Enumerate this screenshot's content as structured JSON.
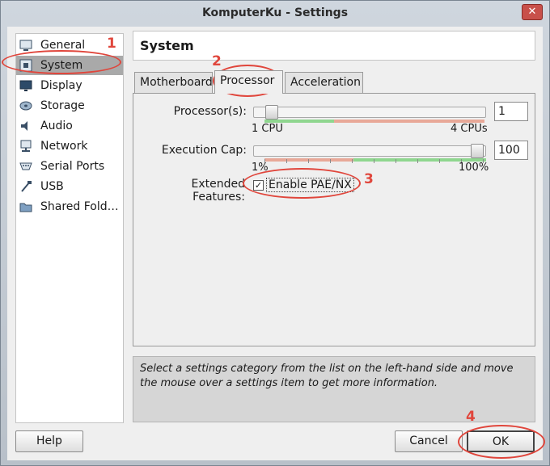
{
  "window": {
    "title": "KomputerKu - Settings",
    "close_glyph": "✕"
  },
  "sidebar": {
    "items": [
      {
        "label": "General",
        "icon": "general-icon"
      },
      {
        "label": "System",
        "icon": "system-icon",
        "selected": true
      },
      {
        "label": "Display",
        "icon": "display-icon"
      },
      {
        "label": "Storage",
        "icon": "storage-icon"
      },
      {
        "label": "Audio",
        "icon": "audio-icon"
      },
      {
        "label": "Network",
        "icon": "network-icon"
      },
      {
        "label": "Serial Ports",
        "icon": "serial-ports-icon"
      },
      {
        "label": "USB",
        "icon": "usb-icon"
      },
      {
        "label": "Shared Fold…",
        "icon": "shared-folders-icon"
      }
    ]
  },
  "main": {
    "title": "System",
    "tabs": [
      {
        "label": "Motherboard",
        "active": false
      },
      {
        "label": "Processor",
        "active": true
      },
      {
        "label": "Acceleration",
        "active": false
      }
    ],
    "processor": {
      "processors_label": "Processor(s):",
      "processors_value": "1",
      "processors_min_label": "1 CPU",
      "processors_max_label": "4 CPUs",
      "processors_level": 0.0,
      "exec_cap_label": "Execution Cap:",
      "exec_cap_value": "100",
      "exec_cap_min_label": "1%",
      "exec_cap_max_label": "100%",
      "exec_cap_level": 1.0,
      "extended_features_label": "Extended Features:",
      "pae_label": "Enable PAE/NX",
      "pae_checked": true,
      "check_glyph": "✓"
    },
    "info_text": "Select a settings category from the list on the left-hand side and move the mouse over a settings item to get more information."
  },
  "buttons": {
    "help": "Help",
    "cancel": "Cancel",
    "ok": "OK"
  },
  "annotations": [
    "1",
    "2",
    "3",
    "4"
  ],
  "colors": {
    "annotation": "#e0463c",
    "scale_green": "#8fd68f",
    "scale_red": "#e8a898",
    "selected_bg": "#a9a9a9"
  }
}
